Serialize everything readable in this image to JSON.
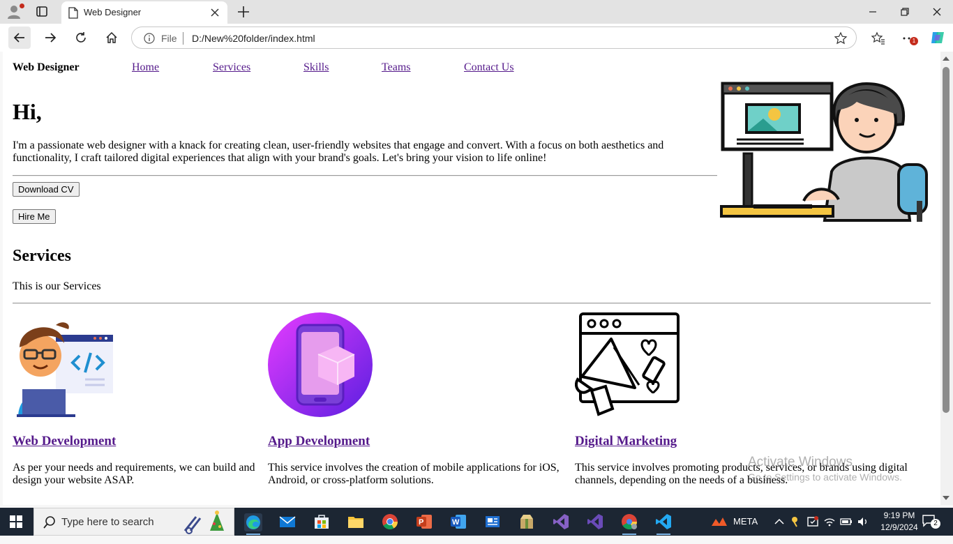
{
  "browser": {
    "tab_title": "Web Designer",
    "scheme_label": "File",
    "url": "D:/New%20folder/index.html",
    "extensions_badge": "1"
  },
  "site": {
    "brand": "Web Designer",
    "nav": [
      {
        "label": "Home"
      },
      {
        "label": "Services"
      },
      {
        "label": "Skills"
      },
      {
        "label": "Teams"
      },
      {
        "label": "Contact Us"
      }
    ],
    "hero": {
      "greeting": "Hi,",
      "intro": "I'm a passionate web designer with a knack for creating clean, user-friendly websites that engage and convert. With a focus on both aesthetics and functionality, I craft tailored digital experiences that align with your brand's goals. Let's bring your vision to life online!",
      "download_label": "Download CV",
      "hire_label": "Hire Me"
    },
    "services": {
      "heading": "Services",
      "subheading": "This is our Services",
      "items": [
        {
          "title": "Web Development",
          "desc": "As per your needs and requirements, we can build and design your website ASAP."
        },
        {
          "title": "App Development",
          "desc": "This service involves the creation of mobile applications for iOS, Android, or cross-platform solutions."
        },
        {
          "title": "Digital Marketing",
          "desc": "This service involves promoting products, services, or brands using digital channels, depending on the needs of a business."
        }
      ]
    }
  },
  "watermark": {
    "line1": "Activate Windows",
    "line2": "Go to Settings to activate Windows."
  },
  "taskbar": {
    "search_placeholder": "Type here to search",
    "tray_label": "META",
    "time": "9:19 PM",
    "date": "12/9/2024",
    "notification_count": "2"
  },
  "colors": {
    "link_visited": "#551a8b",
    "taskbar_bg": "#1c2633",
    "badge_red": "#c42b1c"
  }
}
